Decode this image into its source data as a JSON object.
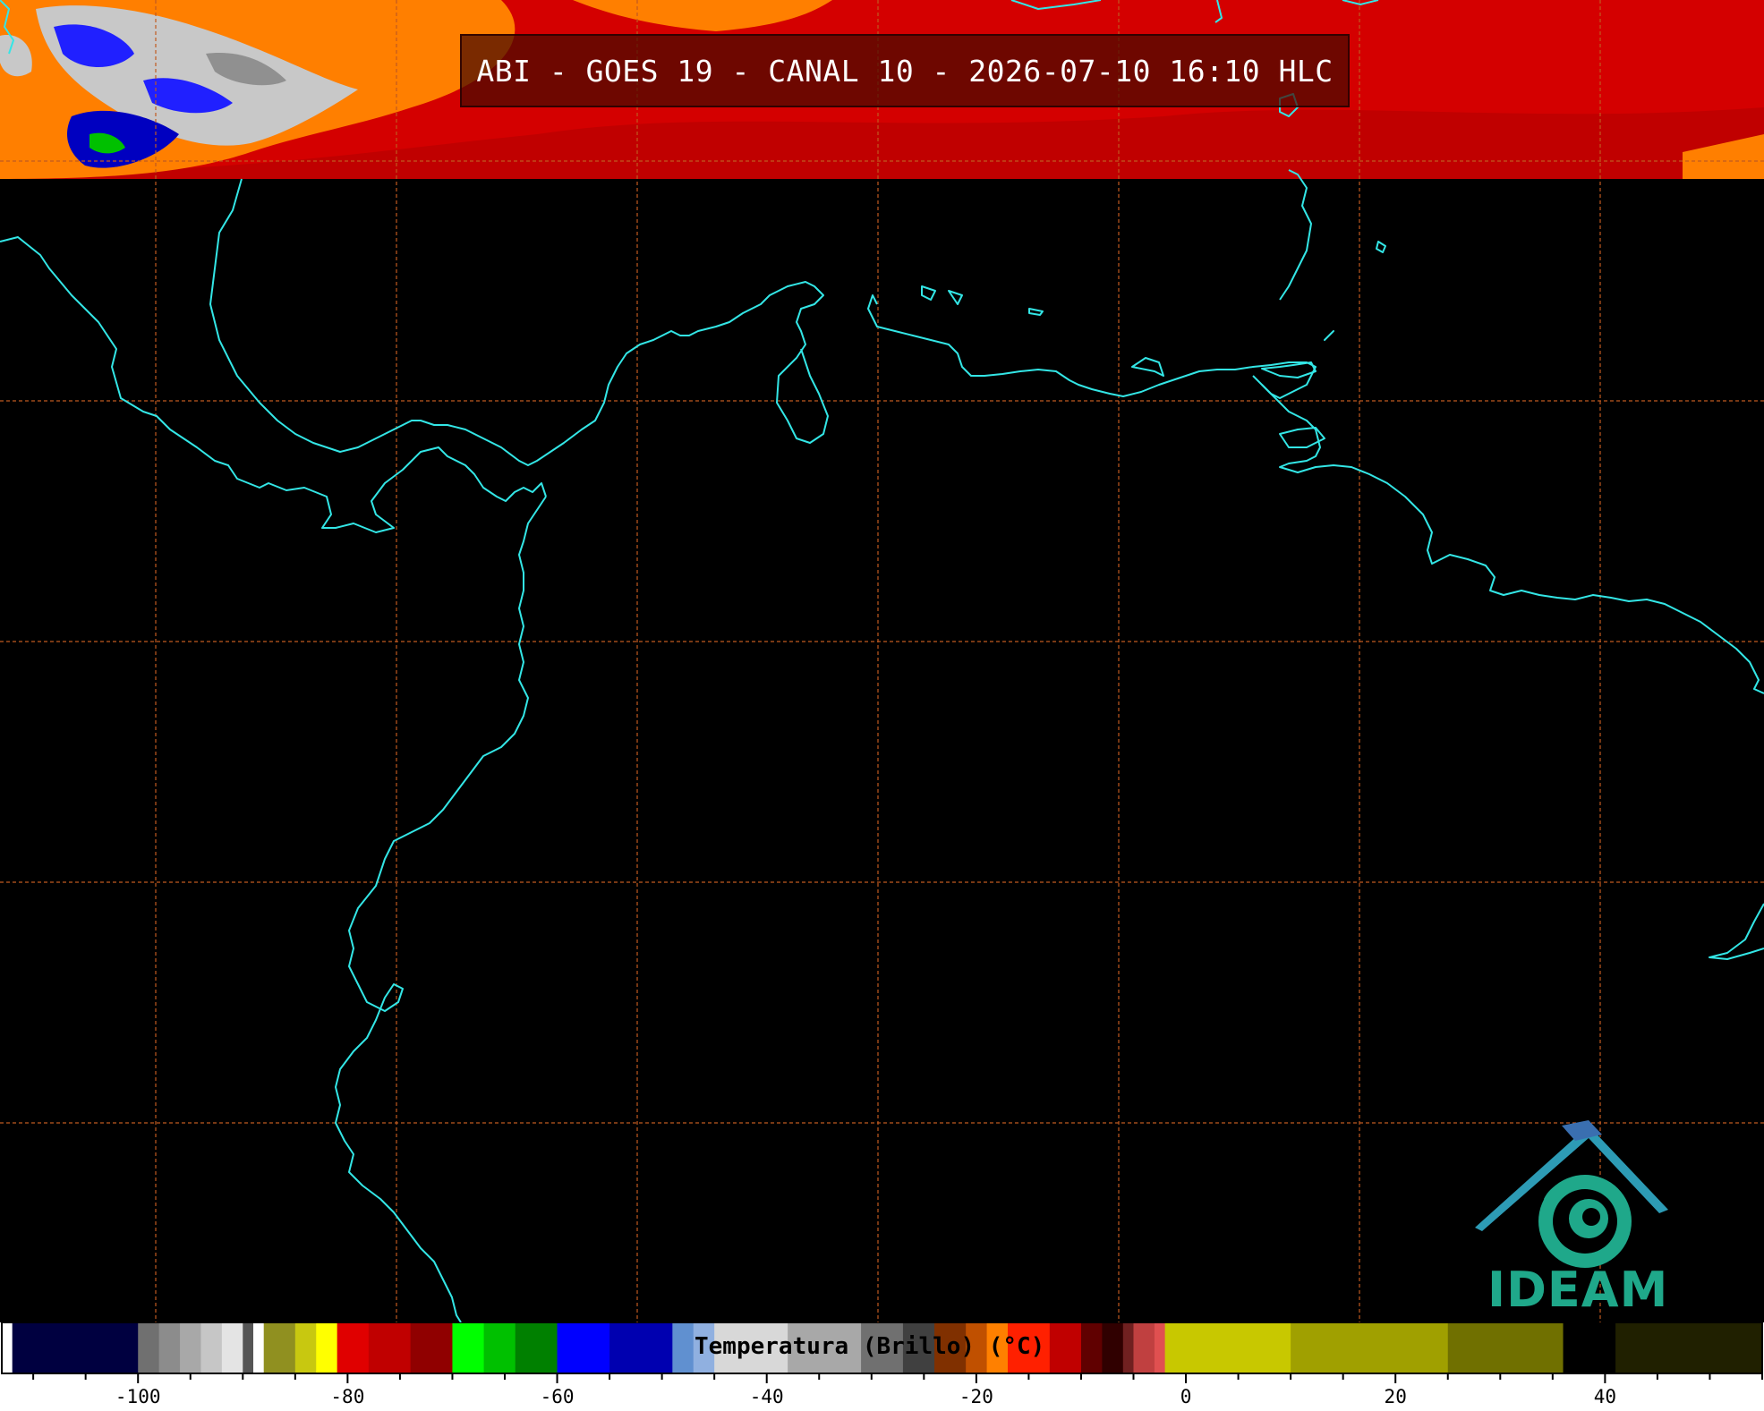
{
  "title": "ABI - GOES 19 - CANAL 10 - 2026-07-10 16:10 HLC",
  "logo_text": "IDEAM",
  "colorbar": {
    "label": "Temperatura (Brillo) (°C)",
    "tick_labels": [
      "-100",
      "-80",
      "-60",
      "-40",
      "-20",
      "0",
      "20",
      "40"
    ],
    "tick_values": [
      -100,
      -80,
      -60,
      -40,
      -20,
      0,
      20,
      40
    ],
    "range": [
      -113,
      55
    ],
    "segments": [
      {
        "from": -113,
        "to": -112,
        "color": "#ffffff"
      },
      {
        "from": -112,
        "to": -100,
        "color": "#000040"
      },
      {
        "from": -100,
        "to": -98,
        "color": "#707070"
      },
      {
        "from": -98,
        "to": -96,
        "color": "#8c8c8c"
      },
      {
        "from": -96,
        "to": -94,
        "color": "#a8a8a8"
      },
      {
        "from": -94,
        "to": -92,
        "color": "#c6c6c6"
      },
      {
        "from": -92,
        "to": -90,
        "color": "#e4e4e4"
      },
      {
        "from": -90,
        "to": -89,
        "color": "#555555"
      },
      {
        "from": -89,
        "to": -88,
        "color": "#ffffff"
      },
      {
        "from": -88,
        "to": -85,
        "color": "#909020"
      },
      {
        "from": -85,
        "to": -83,
        "color": "#c8c810"
      },
      {
        "from": -83,
        "to": -81,
        "color": "#ffff00"
      },
      {
        "from": -81,
        "to": -78,
        "color": "#e00000"
      },
      {
        "from": -78,
        "to": -74,
        "color": "#c00000"
      },
      {
        "from": -74,
        "to": -70,
        "color": "#900000"
      },
      {
        "from": -70,
        "to": -67,
        "color": "#00ff00"
      },
      {
        "from": -67,
        "to": -64,
        "color": "#00c000"
      },
      {
        "from": -64,
        "to": -60,
        "color": "#008000"
      },
      {
        "from": -60,
        "to": -55,
        "color": "#0000ff"
      },
      {
        "from": -55,
        "to": -49,
        "color": "#0000b0"
      },
      {
        "from": -49,
        "to": -47,
        "color": "#6090d0"
      },
      {
        "from": -47,
        "to": -45,
        "color": "#90b0e0"
      },
      {
        "from": -45,
        "to": -38,
        "color": "#d8d8d8"
      },
      {
        "from": -38,
        "to": -31,
        "color": "#a8a8a8"
      },
      {
        "from": -31,
        "to": -27,
        "color": "#707070"
      },
      {
        "from": -27,
        "to": -24,
        "color": "#404040"
      },
      {
        "from": -24,
        "to": -21,
        "color": "#803000"
      },
      {
        "from": -21,
        "to": -19,
        "color": "#c05000"
      },
      {
        "from": -19,
        "to": -17,
        "color": "#ff8000"
      },
      {
        "from": -17,
        "to": -13,
        "color": "#ff2000"
      },
      {
        "from": -13,
        "to": -10,
        "color": "#c00000"
      },
      {
        "from": -10,
        "to": -8,
        "color": "#600000"
      },
      {
        "from": -8,
        "to": -6,
        "color": "#300000"
      },
      {
        "from": -6,
        "to": -5,
        "color": "#702020"
      },
      {
        "from": -5,
        "to": -3,
        "color": "#c04040"
      },
      {
        "from": -3,
        "to": -2,
        "color": "#e05050"
      },
      {
        "from": -2,
        "to": 10,
        "color": "#c8c800"
      },
      {
        "from": 10,
        "to": 25,
        "color": "#a0a000"
      },
      {
        "from": 25,
        "to": 36,
        "color": "#707000"
      },
      {
        "from": 36,
        "to": 41,
        "color": "#000000"
      },
      {
        "from": 41,
        "to": 55,
        "color": "#202000"
      }
    ]
  }
}
